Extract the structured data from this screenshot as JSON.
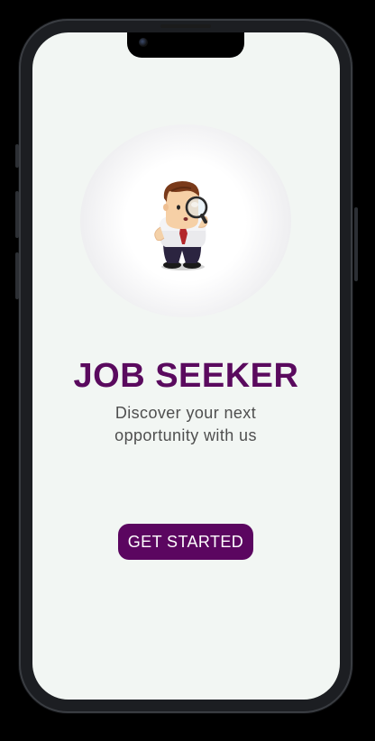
{
  "onboarding": {
    "title": "JOB SEEKER",
    "subtitle": "Discover your next opportunity with us",
    "cta_label": "GET STARTED",
    "illustration_icon": "job-seeker-magnifier-illustration"
  },
  "colors": {
    "brand": "#5b0660",
    "title": "#5a0a5e",
    "screen_bg": "#f2f6f3",
    "subtitle": "#4f4f4f"
  }
}
